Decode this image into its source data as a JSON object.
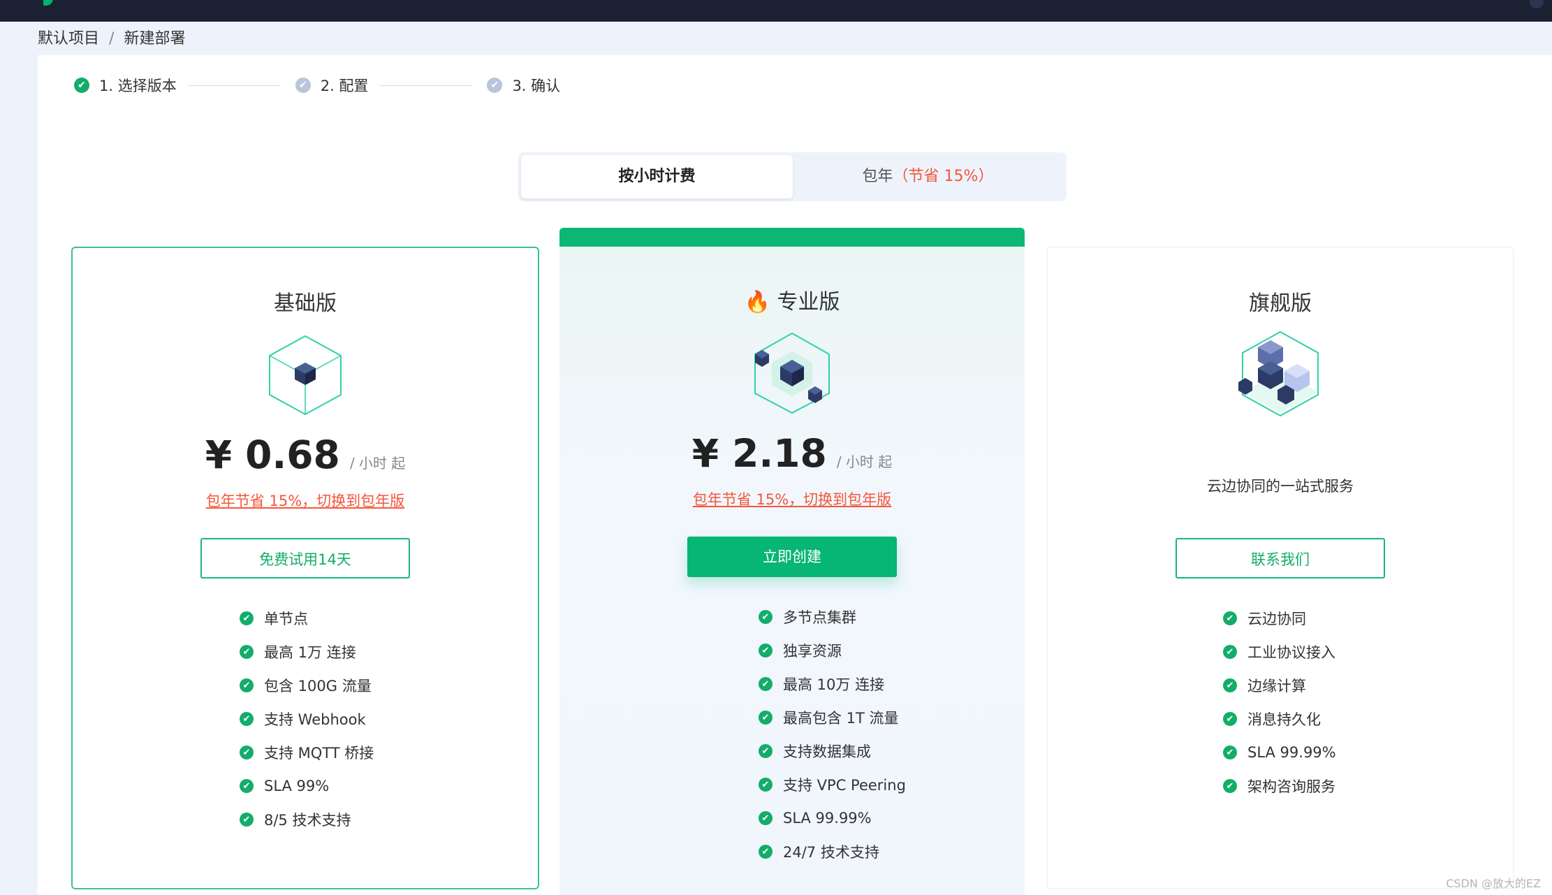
{
  "breadcrumb": {
    "items": [
      "默认项目",
      "新建部署"
    ],
    "separator": "/"
  },
  "steps": [
    {
      "label": "1. 选择版本",
      "state": "done"
    },
    {
      "label": "2. 配置",
      "state": "todo"
    },
    {
      "label": "3. 确认",
      "state": "todo"
    }
  ],
  "billing_toggle": {
    "hourly": "按小时计费",
    "yearly": "包年",
    "yearly_save": "（节省 15%）",
    "selected": "hourly"
  },
  "plans": {
    "basic": {
      "title": "基础版",
      "price": "¥ 0.68",
      "unit": "/ 小时 起",
      "promo": "包年节省 15%，切换到包年版",
      "button": "免费试用14天",
      "features": [
        "单节点",
        "最高 1万 连接",
        "包含 100G 流量",
        "支持 Webhook",
        "支持 MQTT 桥接",
        "SLA 99%",
        "8/5 技术支持"
      ]
    },
    "pro": {
      "title": "专业版",
      "price": "¥ 2.18",
      "unit": "/ 小时 起",
      "promo": "包年节省 15%，切换到包年版",
      "button": "立即创建",
      "features": [
        "多节点集群",
        "独享资源",
        "最高 10万 连接",
        "最高包含 1T 流量",
        "支持数据集成",
        "支持 VPC Peering",
        "SLA 99.99%",
        "24/7 技术支持"
      ]
    },
    "flagship": {
      "title": "旗舰版",
      "description": "云边协同的一站式服务",
      "button": "联系我们",
      "features": [
        "云边协同",
        "工业协议接入",
        "边缘计算",
        "消息持久化",
        "SLA 99.99%",
        "架构咨询服务"
      ]
    }
  },
  "colors": {
    "accent": "#07b574",
    "promo": "#f5563a",
    "topbar": "#1b2133"
  },
  "watermark": "CSDN @放大的EZ"
}
